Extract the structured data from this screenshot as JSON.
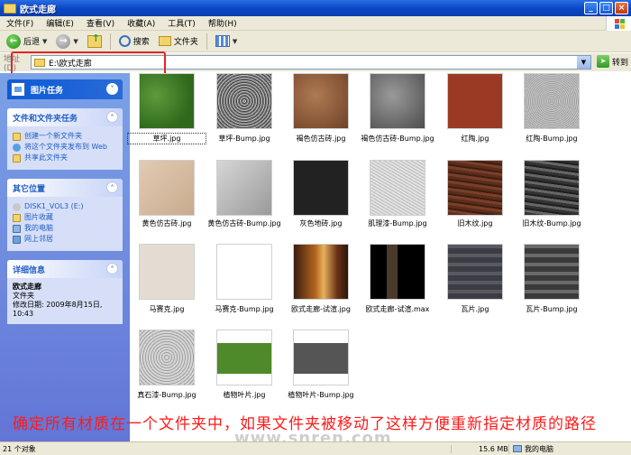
{
  "window": {
    "title": "欧式走廊"
  },
  "menu": [
    "文件(F)",
    "编辑(E)",
    "查看(V)",
    "收藏(A)",
    "工具(T)",
    "帮助(H)"
  ],
  "toolbar": {
    "back": "后退",
    "search": "搜索",
    "folders": "文件夹"
  },
  "address": {
    "label": "地址(D)",
    "value": "E:\\欧式走廊",
    "go": "转到"
  },
  "sidebar": {
    "picture_tasks": "图片任务",
    "file_tasks": {
      "title": "文件和文件夹任务",
      "items": [
        "创建一个新文件夹",
        "将这个文件夹发布到 Web",
        "共享此文件夹"
      ]
    },
    "other_places": {
      "title": "其它位置",
      "items": [
        "DISK1_VOL3 (E:)",
        "图片收藏",
        "我的电脑",
        "网上邻居"
      ]
    },
    "details": {
      "title": "详细信息",
      "name": "欧式走廊",
      "type": "文件夹",
      "modified": "修改日期: 2009年8月15日, 10:43"
    }
  },
  "files": [
    "草坪.jpg",
    "草坪-Bump.jpg",
    "褐色仿古砖.jpg",
    "褐色仿古砖-Bump.jpg",
    "红陶.jpg",
    "红陶-Bump.jpg",
    "黄色仿古砖.jpg",
    "黄色仿古砖-Bump.jpg",
    "灰色地砖.jpg",
    "肌理漆-Bump.jpg",
    "旧木纹.jpg",
    "旧木纹-Bump.jpg",
    "马赛克.jpg",
    "马赛克-Bump.jpg",
    "欧式走廊-试渲.jpg",
    "欧式走廊-试渲.max",
    "瓦片.jpg",
    "瓦片-Bump.jpg",
    "真石漆-Bump.jpg",
    "植物叶片.jpg",
    "植物叶片-Bump.jpg"
  ],
  "overlay": "确定所有材质在一个文件夹中，如果文件夹被移动了这样方便重新指定材质的路径",
  "watermark": "www.snren.com",
  "status": {
    "count": "21 个对象",
    "size": "15.6 MB",
    "location": "我的电脑"
  }
}
